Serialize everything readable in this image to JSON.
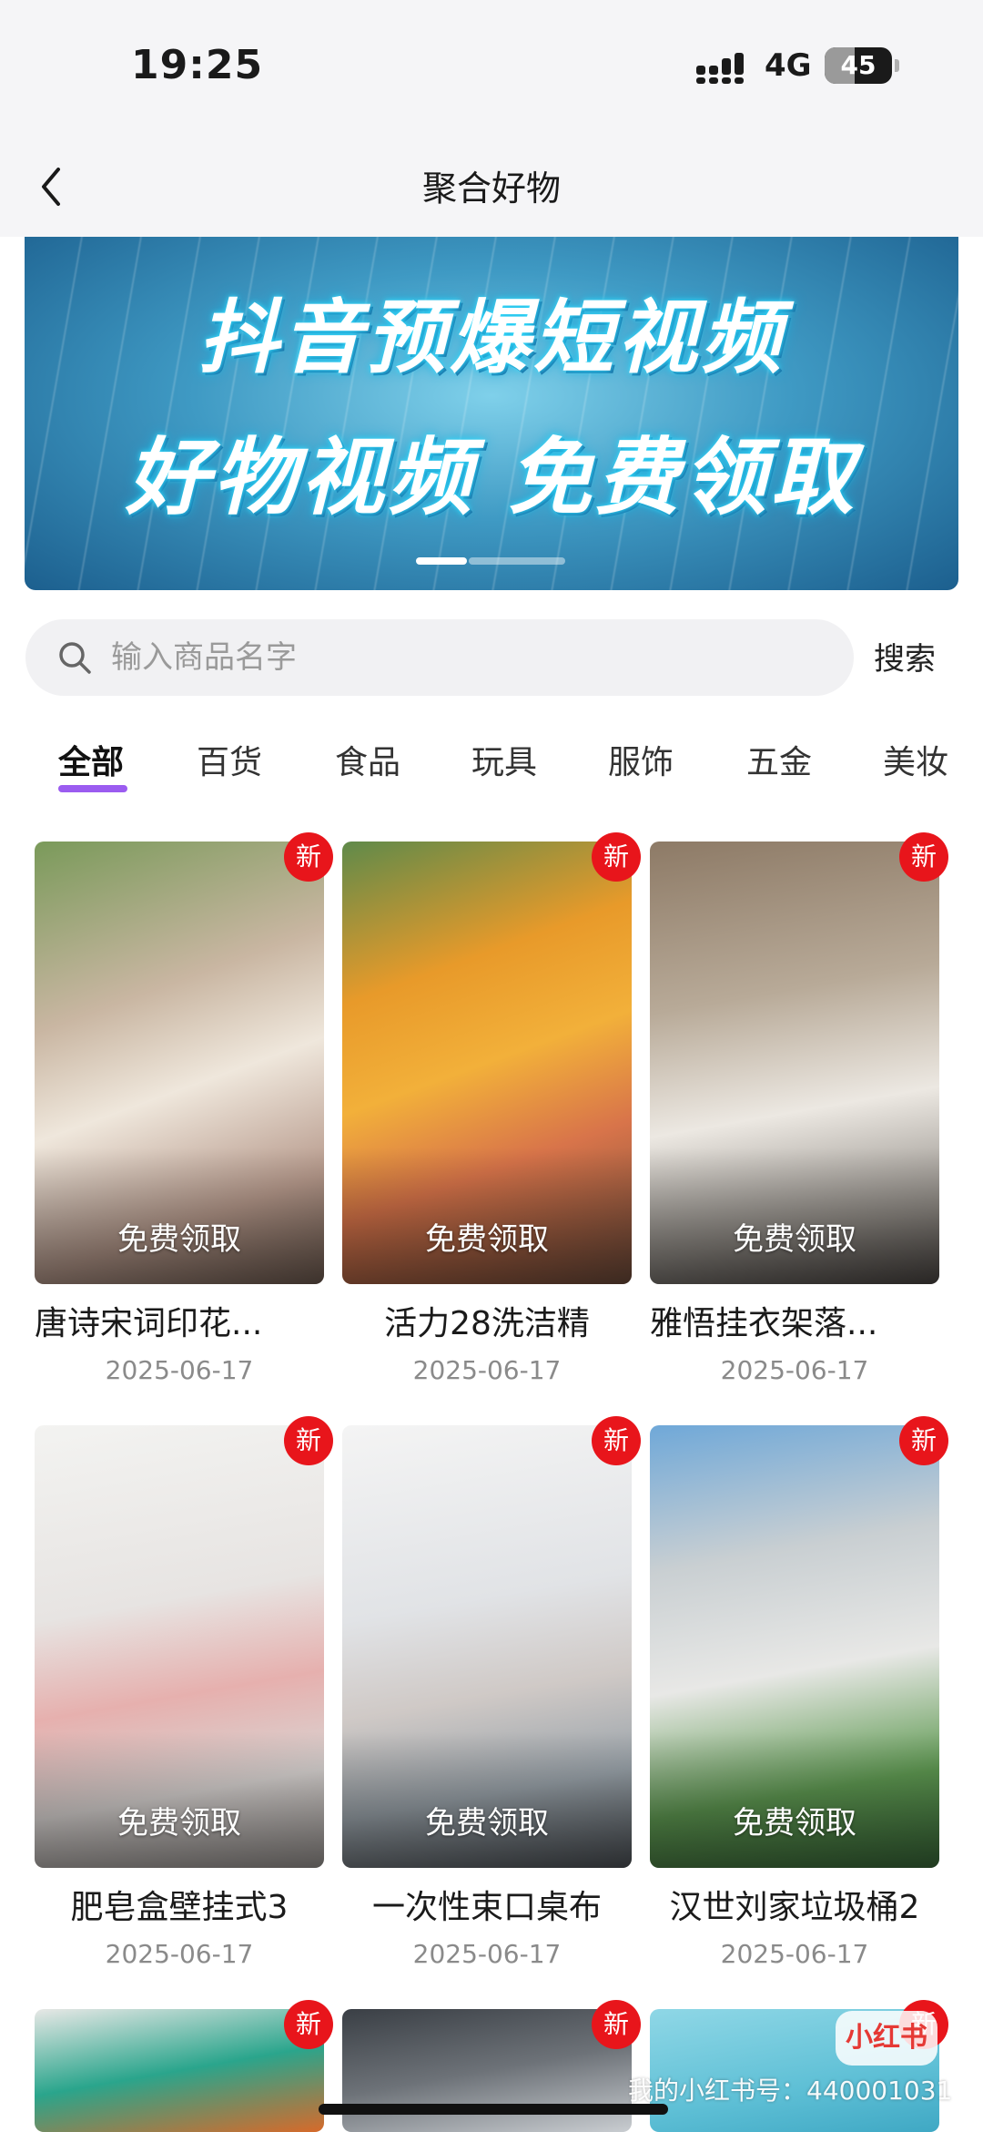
{
  "status_bar": {
    "time": "19:25",
    "network": "4G",
    "battery": "45",
    "battery_level": 0.45
  },
  "header": {
    "title": "聚合好物"
  },
  "banner": {
    "line1": "抖音预爆短视频",
    "line2": "好物视频 免费领取"
  },
  "search": {
    "placeholder": "输入商品名字",
    "value": "",
    "button_label": "搜索"
  },
  "tabs": [
    "全部",
    "百货",
    "食品",
    "玩具",
    "服饰",
    "五金",
    "美妆"
  ],
  "active_tab": "全部",
  "product_badge": "新",
  "claim_label": "免费领取",
  "products": [
    {
      "title": "唐诗宋词印花...",
      "date": "2025-06-17"
    },
    {
      "title": "活力28洗洁精",
      "date": "2025-06-17"
    },
    {
      "title": "雅悟挂衣架落...",
      "date": "2025-06-17"
    },
    {
      "title": "肥皂盒壁挂式3",
      "date": "2025-06-17"
    },
    {
      "title": "一次性束口桌布",
      "date": "2025-06-17"
    },
    {
      "title": "汉世刘家垃圾桶2",
      "date": "2025-06-17"
    }
  ],
  "watermark": {
    "logo": "小红书",
    "text": "我的小红书号：440001031"
  },
  "colors": {
    "accent": "#9b5cf0",
    "badge": "#e8151b",
    "banner": "#3f9ac4"
  }
}
